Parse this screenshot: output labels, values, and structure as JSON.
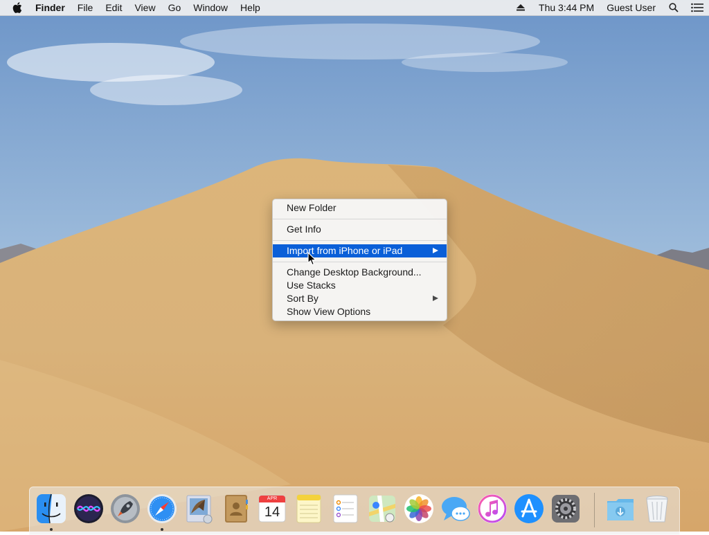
{
  "menubar": {
    "app_name": "Finder",
    "menus": [
      "File",
      "Edit",
      "View",
      "Go",
      "Window",
      "Help"
    ],
    "clock": "Thu 3:44 PM",
    "user": "Guest User"
  },
  "context_menu": {
    "items": [
      {
        "label": "New Folder"
      },
      {
        "label": "Get Info"
      },
      {
        "label": "Import from iPhone or iPad",
        "submenu": true,
        "highlighted": true
      },
      {
        "label": "Change Desktop Background..."
      },
      {
        "label": "Use Stacks"
      },
      {
        "label": "Sort By",
        "submenu": true
      },
      {
        "label": "Show View Options"
      }
    ]
  },
  "dock": {
    "apps": [
      "Finder",
      "Siri",
      "Launchpad",
      "Safari",
      "Mail",
      "Contacts",
      "Calendar",
      "Notes",
      "Reminders",
      "Maps",
      "Photos",
      "Messages",
      "iTunes",
      "App Store",
      "System Preferences",
      "Downloads",
      "Trash"
    ],
    "running": [
      "Finder",
      "Safari"
    ],
    "calendar_month": "APR",
    "calendar_day": "14"
  },
  "colors": {
    "menu_highlight": "#0a5fd8",
    "menubar_bg": "#f0f0f0"
  }
}
